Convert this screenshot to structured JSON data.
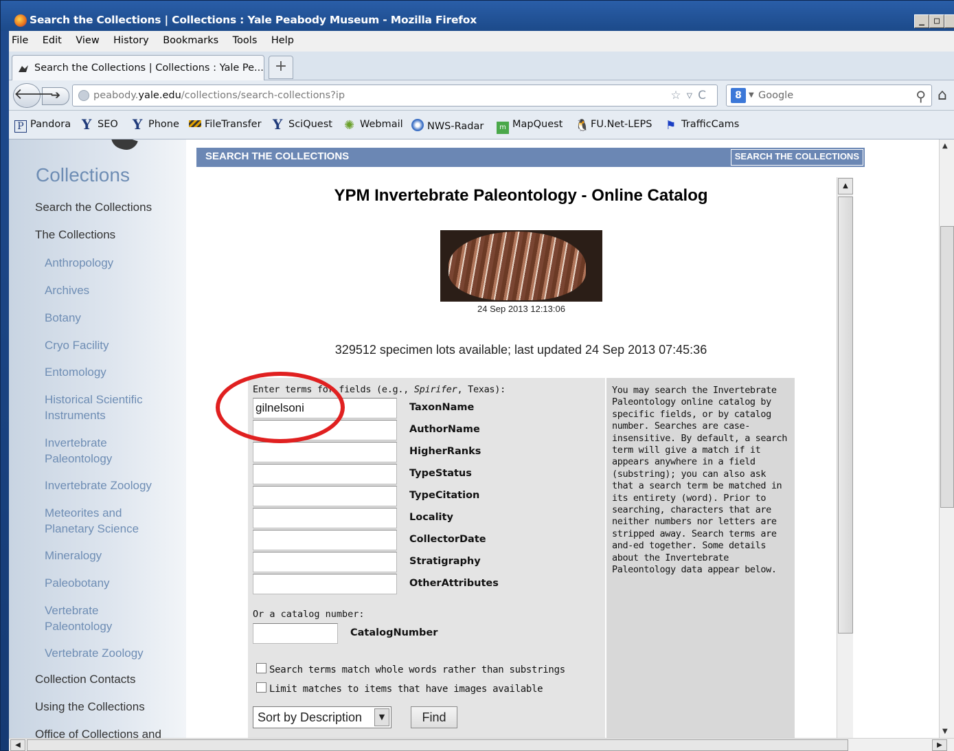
{
  "window": {
    "title": "Search the Collections | Collections : Yale Peabody Museum - Mozilla Firefox",
    "controls": [
      "_",
      "□",
      "×"
    ]
  },
  "menu": [
    "File",
    "Edit",
    "View",
    "History",
    "Bookmarks",
    "Tools",
    "Help"
  ],
  "tab": {
    "label": "Search the Collections | Collections : Yale Pe...",
    "new_tab": "+"
  },
  "nav": {
    "url_prefix": "peabody.",
    "url_domain": "yale.edu",
    "url_path": "/collections/search-collections?ip",
    "search_engine": "Google",
    "search_engine_badge": "8"
  },
  "bookmarks": [
    "Pandora",
    "SEO",
    "Phone",
    "FileTransfer",
    "SciQuest",
    "Webmail",
    "NWS-Radar",
    "MapQuest",
    "FU.Net-LEPS",
    "TrafficCams"
  ],
  "sidebar": {
    "title": "Collections",
    "items": [
      "Search the Collections",
      "The Collections",
      "Anthropology",
      "Archives",
      "Botany",
      "Cryo Facility",
      "Entomology",
      "Historical Scientific Instruments",
      "Invertebrate Paleontology",
      "Invertebrate Zoology",
      "Meteorites and Planetary Science",
      "Mineralogy",
      "Paleobotany",
      "Vertebrate Paleontology",
      "Vertebrate Zoology",
      "Collection Contacts",
      "Using the Collections",
      "Office of Collections and"
    ]
  },
  "banner": {
    "left": "SEARCH THE COLLECTIONS",
    "right": "SEARCH THE COLLECTIONS"
  },
  "catalog": {
    "title": "YPM Invertebrate Paleontology - Online Catalog",
    "photo_caption": "24 Sep 2013 12:13:06",
    "availability": "329512 specimen lots available; last updated 24 Sep 2013 07:45:36"
  },
  "form": {
    "prompt_prefix": "Enter terms for fields (e.g., ",
    "prompt_example": "Spirifer",
    "prompt_suffix": ", Texas):",
    "fields": [
      {
        "label": "TaxonName",
        "value": "gilnelsoni"
      },
      {
        "label": "AuthorName",
        "value": ""
      },
      {
        "label": "HigherRanks",
        "value": ""
      },
      {
        "label": "TypeStatus",
        "value": ""
      },
      {
        "label": "TypeCitation",
        "value": ""
      },
      {
        "label": "Locality",
        "value": ""
      },
      {
        "label": "CollectorDate",
        "value": ""
      },
      {
        "label": "Stratigraphy",
        "value": ""
      },
      {
        "label": "OtherAttributes",
        "value": ""
      }
    ],
    "catalog_prompt": "Or a catalog number:",
    "catalog_label": "CatalogNumber",
    "catalog_value": "",
    "check_whole_words": "Search terms match whole words rather than substrings",
    "check_images": "Limit matches to items that have images available",
    "sort_value": "Sort by Description",
    "find_label": "Find"
  },
  "help_text": "You may search the Invertebrate Paleontology online catalog by specific fields, or by catalog number. Searches are case-insensitive. By default, a search term will give a match if it appears anywhere in a field (substring); you can also ask that a search term be matched in its entirety (word). Prior to searching, characters that are neither numbers nor letters are stripped away. Search terms are and-ed together. Some details about the Invertebrate Paleontology data appear below.",
  "colors": {
    "annotation": "#e02020",
    "banner": "#6b87b4",
    "sidebar_link": "#6e8db4"
  }
}
